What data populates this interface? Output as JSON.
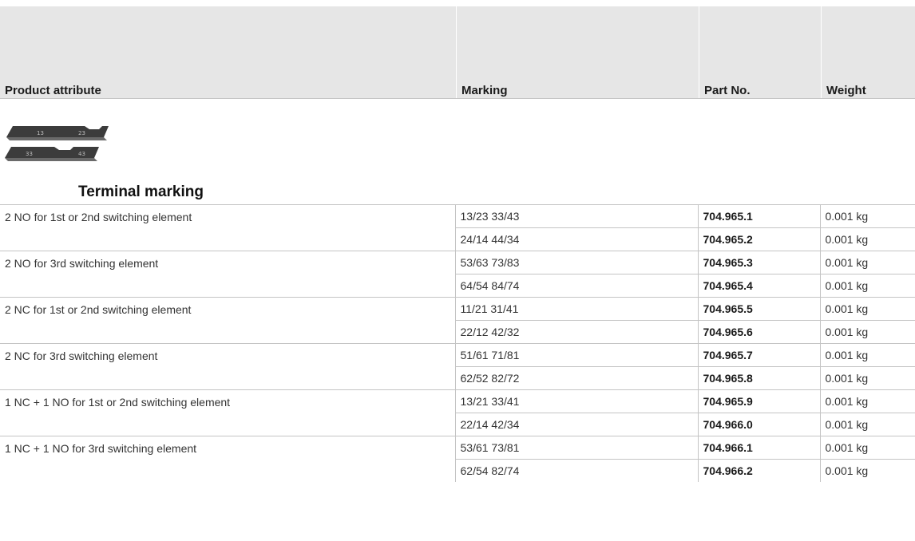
{
  "header": {
    "col_attribute": "Product attribute",
    "col_marking": "Marking",
    "col_part": "Part No.",
    "col_weight": "Weight"
  },
  "section": {
    "title": "Terminal marking",
    "image_icon": "terminal-marker-strips-image",
    "image_labels": [
      "13",
      "23",
      "33",
      "43"
    ]
  },
  "groups": [
    {
      "attribute": "2 NO for 1st or 2nd switching element",
      "rows": [
        {
          "marking": "13/23 33/43",
          "part": "704.965.1",
          "weight": "0.001 kg"
        },
        {
          "marking": "24/14 44/34",
          "part": "704.965.2",
          "weight": "0.001 kg"
        }
      ]
    },
    {
      "attribute": "2 NO for 3rd switching element",
      "rows": [
        {
          "marking": "53/63 73/83",
          "part": "704.965.3",
          "weight": "0.001 kg"
        },
        {
          "marking": "64/54 84/74",
          "part": "704.965.4",
          "weight": "0.001 kg"
        }
      ]
    },
    {
      "attribute": "2 NC for 1st or 2nd switching element",
      "rows": [
        {
          "marking": "11/21 31/41",
          "part": "704.965.5",
          "weight": "0.001 kg"
        },
        {
          "marking": "22/12 42/32",
          "part": "704.965.6",
          "weight": "0.001 kg"
        }
      ]
    },
    {
      "attribute": "2 NC for 3rd switching element",
      "rows": [
        {
          "marking": "51/61 71/81",
          "part": "704.965.7",
          "weight": "0.001 kg"
        },
        {
          "marking": "62/52 82/72",
          "part": "704.965.8",
          "weight": "0.001 kg"
        }
      ]
    },
    {
      "attribute": "1 NC + 1 NO for 1st or 2nd switching element",
      "rows": [
        {
          "marking": "13/21 33/41",
          "part": "704.965.9",
          "weight": "0.001 kg"
        },
        {
          "marking": "22/14 42/34",
          "part": "704.966.0",
          "weight": "0.001 kg"
        }
      ]
    },
    {
      "attribute": "1 NC + 1 NO for 3rd switching element",
      "rows": [
        {
          "marking": "53/61 73/81",
          "part": "704.966.1",
          "weight": "0.001 kg"
        },
        {
          "marking": "62/54 82/74",
          "part": "704.966.2",
          "weight": "0.001 kg"
        }
      ]
    }
  ]
}
